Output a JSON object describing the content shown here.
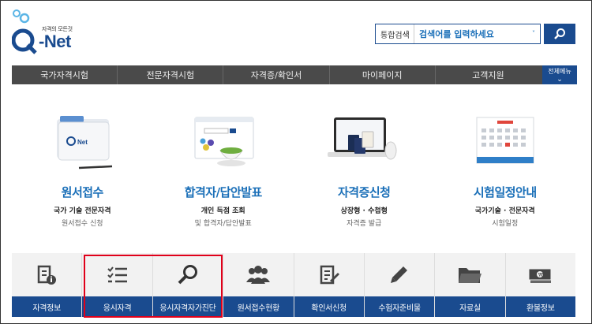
{
  "header": {
    "logo_tagline": "자격의 모든것",
    "logo_text": "-Net",
    "search_category": "통합검색",
    "search_placeholder": "검색어를 입력하세요"
  },
  "nav": {
    "items": [
      "국가자격시험",
      "전문자격시험",
      "자격증/확인서",
      "마이페이지",
      "고객지원"
    ],
    "all_menu_label": "전체메뉴"
  },
  "features": [
    {
      "title": "원서접수",
      "sub": "국가 기술 전문자격",
      "desc": "원서접수 신청"
    },
    {
      "title": "합격자/답안발표",
      "sub": "개인 득점 조회",
      "desc": "및 합격자/답안발표"
    },
    {
      "title": "자격증신청",
      "sub": "상장형 · 수첩형",
      "desc": "자격증 발급"
    },
    {
      "title": "시험일정안내",
      "sub": "국가기술 · 전문자격",
      "desc": "시험일정"
    }
  ],
  "tiles": [
    {
      "label": "자격정보",
      "icon": "info-document-icon"
    },
    {
      "label": "응시자격",
      "icon": "checklist-icon"
    },
    {
      "label": "응시자격자가진단",
      "icon": "magnifier-icon"
    },
    {
      "label": "원서접수현황",
      "icon": "people-icon"
    },
    {
      "label": "확인서신청",
      "icon": "document-edit-icon"
    },
    {
      "label": "수험자준비물",
      "icon": "pencil-icon"
    },
    {
      "label": "자료실",
      "icon": "folder-icon"
    },
    {
      "label": "환불정보",
      "icon": "money-icon"
    }
  ],
  "colors": {
    "brand_blue": "#1a4b8f",
    "link_blue": "#1a6fb8",
    "nav_gray": "#4a4a4a",
    "highlight_red": "#e0001a"
  }
}
